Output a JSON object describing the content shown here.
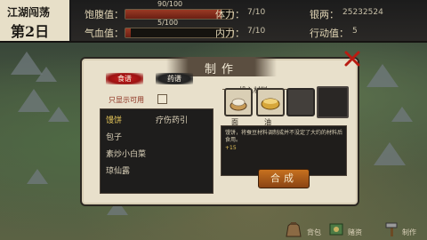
{
  "day": {
    "name": "江湖闯荡",
    "number": "第2日"
  },
  "stats": {
    "hunger_label": "饱腹值：",
    "hunger_value": "90/100",
    "hunger_fraction": 0.9,
    "blood_label": "气血值：",
    "blood_value": "5/100",
    "blood_fraction": 0.05,
    "strength_label": "体力：",
    "strength_value": "7/10",
    "inner_label": "内力：",
    "inner_value": "7/10",
    "money_label": "银两：",
    "money_value": "25232524",
    "action_label": "行动值：",
    "action_value": "5"
  },
  "panel": {
    "title": "制作",
    "tabs": [
      {
        "label": "食谱",
        "active": true
      },
      {
        "label": "药谱",
        "active": false
      }
    ],
    "only_show_label": "只显示可用",
    "recipes": [
      "馒饼",
      "疗伤药引",
      "包子",
      "素炒小白菜",
      "琼仙露"
    ],
    "materials_label": "投入材料",
    "materials": [
      {
        "name": "面"
      },
      {
        "name": "油"
      }
    ],
    "description": "馒饼，将蚕豆材料调制成并不没定了大约的材料后食用。",
    "description_extra": "+15",
    "make_button": "合成"
  },
  "nav": {
    "bag": "背包",
    "trade": "赌资",
    "make": "制作"
  },
  "colors": {
    "panel_bg": "#e8e0cb",
    "bar_fill": "#9a3a25",
    "button": "#c7711f",
    "selected": "#e6c65a"
  }
}
